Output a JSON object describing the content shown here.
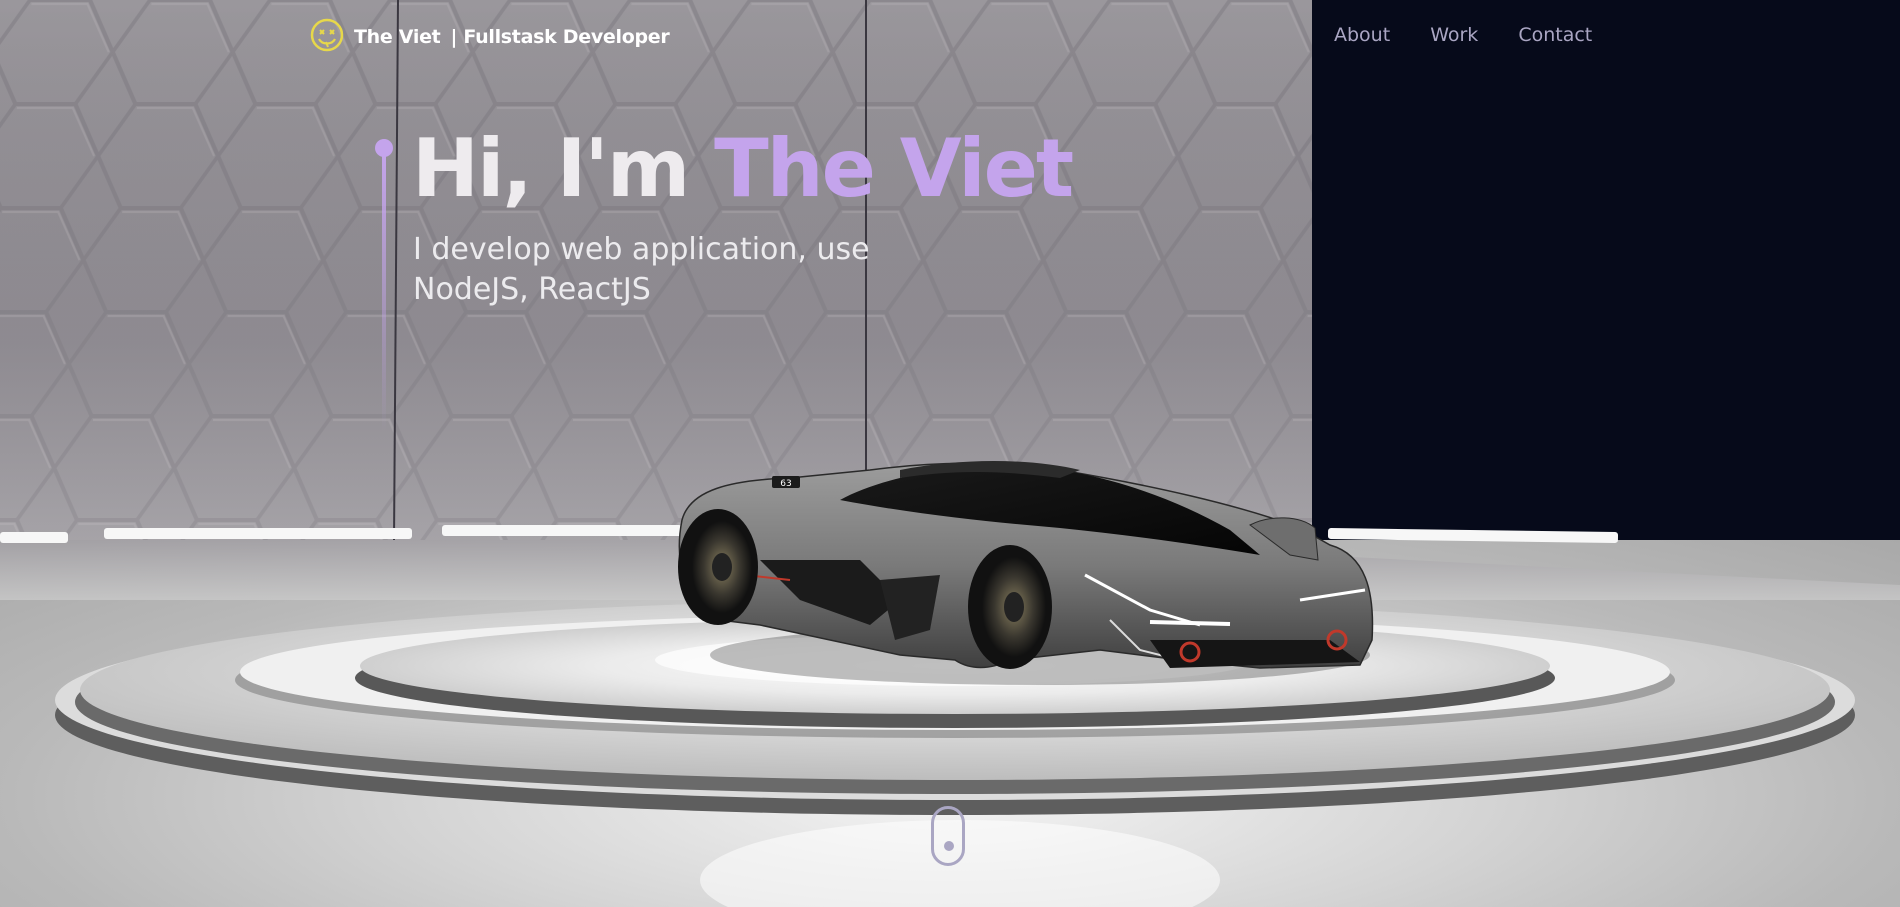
{
  "header": {
    "brand_name": "The Viet",
    "brand_tagline": "| Fullstask Developer",
    "logo_icon": "smiley-face-icon",
    "nav": [
      {
        "label": "About"
      },
      {
        "label": "Work"
      },
      {
        "label": "Contact"
      }
    ]
  },
  "hero": {
    "greeting": "Hi, I'm",
    "name": "The Viet",
    "subtitle_line1": "I develop web application, use",
    "subtitle_line2": "NodeJS, ReactJS"
  },
  "scene": {
    "car_badge": "63",
    "scroll_icon": "mouse-scroll-icon"
  },
  "colors": {
    "accent": "#c4a4ec",
    "nav_text": "#aaa6c3",
    "dark_panel": "#060a1a",
    "logo": "#e7d84a"
  }
}
